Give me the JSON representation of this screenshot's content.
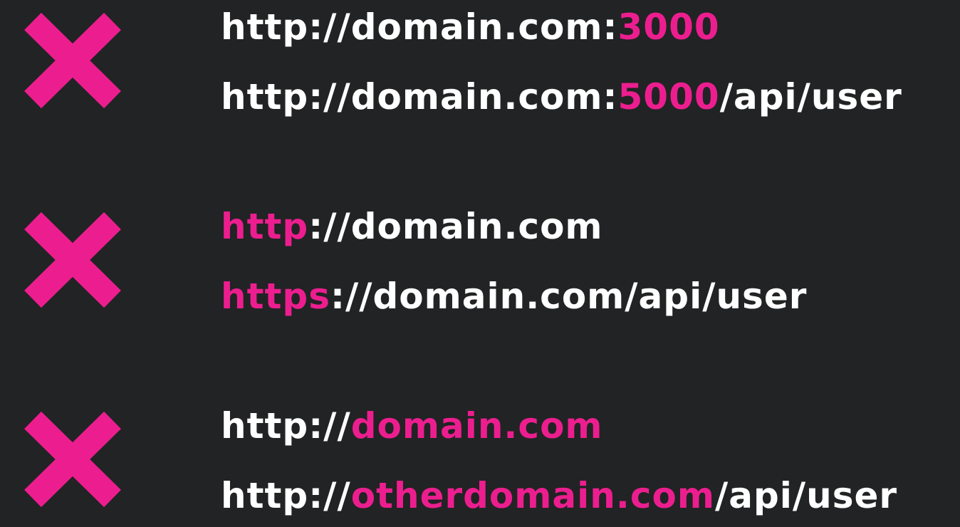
{
  "colors": {
    "background": "#222324",
    "text": "#ffffff",
    "accent": "#ec1e8f"
  },
  "groups": [
    {
      "icon": "x-mark-icon",
      "lines": [
        [
          {
            "text": "http://domain.com:",
            "highlight": false
          },
          {
            "text": "3000",
            "highlight": true
          }
        ],
        [
          {
            "text": "http://domain.com:",
            "highlight": false
          },
          {
            "text": "5000",
            "highlight": true
          },
          {
            "text": "/api/user",
            "highlight": false
          }
        ]
      ]
    },
    {
      "icon": "x-mark-icon",
      "lines": [
        [
          {
            "text": "http",
            "highlight": true
          },
          {
            "text": "://domain.com",
            "highlight": false
          }
        ],
        [
          {
            "text": "https",
            "highlight": true
          },
          {
            "text": "://domain.com/api/user",
            "highlight": false
          }
        ]
      ]
    },
    {
      "icon": "x-mark-icon",
      "lines": [
        [
          {
            "text": "http://",
            "highlight": false
          },
          {
            "text": "domain.com",
            "highlight": true
          }
        ],
        [
          {
            "text": "http://",
            "highlight": false
          },
          {
            "text": "otherdomain.com",
            "highlight": true
          },
          {
            "text": "/api/user",
            "highlight": false
          }
        ]
      ]
    }
  ]
}
